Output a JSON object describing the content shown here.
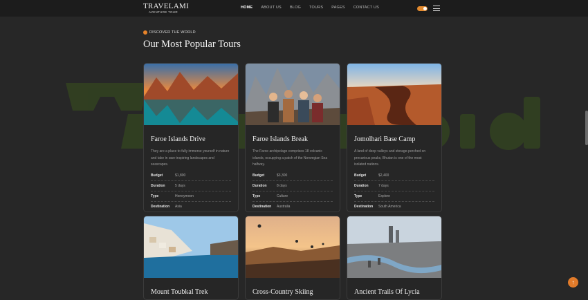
{
  "brand": {
    "name": "TRAVELAMI",
    "tagline": "AVENTURE TOUR"
  },
  "nav": {
    "items": [
      {
        "label": "HOME",
        "active": true
      },
      {
        "label": "ABOUT US",
        "active": false
      },
      {
        "label": "BLOG",
        "active": false
      },
      {
        "label": "TOURS",
        "active": false
      },
      {
        "label": "PAGES",
        "active": false
      },
      {
        "label": "CONTACT US",
        "active": false
      }
    ]
  },
  "section": {
    "eyebrow": "DISCOVER THE WORLD",
    "title": "Our Most Popular Tours"
  },
  "labels": {
    "budget": "Budget",
    "duration": "Duration",
    "type": "Type",
    "destination": "Destination"
  },
  "tours": [
    {
      "title": "Faroe Islands Drive",
      "desc": "They are a place to fully immerse yourself in nature and take in awe-inspiring landscapes and seascapes.",
      "budget": "$1,800",
      "duration": "5 days",
      "type": "Honeymoon",
      "destination": "Asia"
    },
    {
      "title": "Faroe Islands Break",
      "desc": "The Faroe archipelago comprises 18 volcanic islands, occupying a patch of the Norwegian Sea halfway.",
      "budget": "$3,300",
      "duration": "8 days",
      "type": "Culture",
      "destination": "Australia"
    },
    {
      "title": "Jomolhari Base Camp",
      "desc": "A land of deep valleys and storage-perched on precarious peaks, Bhutan is one of the most isolated nations.",
      "budget": "$2,400",
      "duration": "7 days",
      "type": "Explore",
      "destination": "South America"
    },
    {
      "title": "Mount Toubkal Trek"
    },
    {
      "title": "Cross-Country Skiing"
    },
    {
      "title": "Ancient Trails Of Lycia"
    }
  ],
  "colors": {
    "accent": "#e6832a",
    "background": "#272727",
    "card": "#262626"
  }
}
